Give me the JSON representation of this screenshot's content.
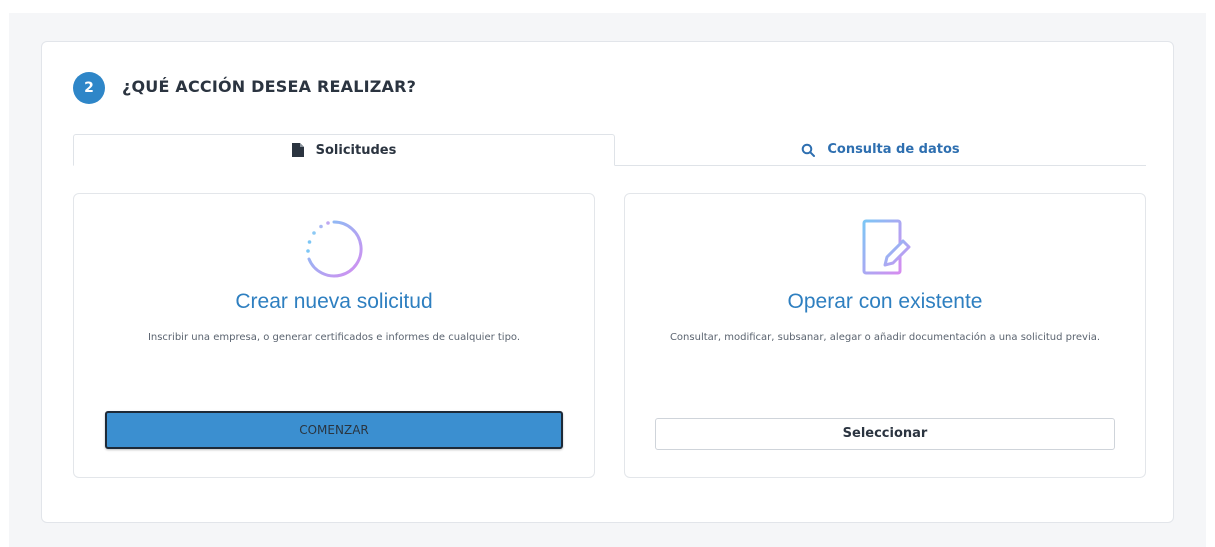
{
  "step": {
    "number": "2",
    "title": "¿QUÉ ACCIÓN DESEA REALIZAR?"
  },
  "tabs": [
    {
      "label": "Solicitudes",
      "icon": "document-icon",
      "active": true
    },
    {
      "label": "Consulta de datos",
      "icon": "search-icon",
      "active": false
    }
  ],
  "cards": [
    {
      "icon": "add-circle-icon",
      "title": "Crear nueva solicitud",
      "description": "Inscribir una empresa, o generar certificados e informes de cualquier tipo.",
      "button_label": "COMENZAR"
    },
    {
      "icon": "edit-document-icon",
      "title": "Operar con existente",
      "description": "Consultar, modificar, subsanar, alegar o añadir documentación a una solicitud previa.",
      "button_label": "Seleccionar"
    }
  ],
  "colors": {
    "accent": "#2e86c8",
    "title_blue": "#2e7fc0",
    "button_primary": "#3b8fd0",
    "icon_gradient_start": "#7cc6f5",
    "icon_gradient_end": "#d68cf0"
  }
}
